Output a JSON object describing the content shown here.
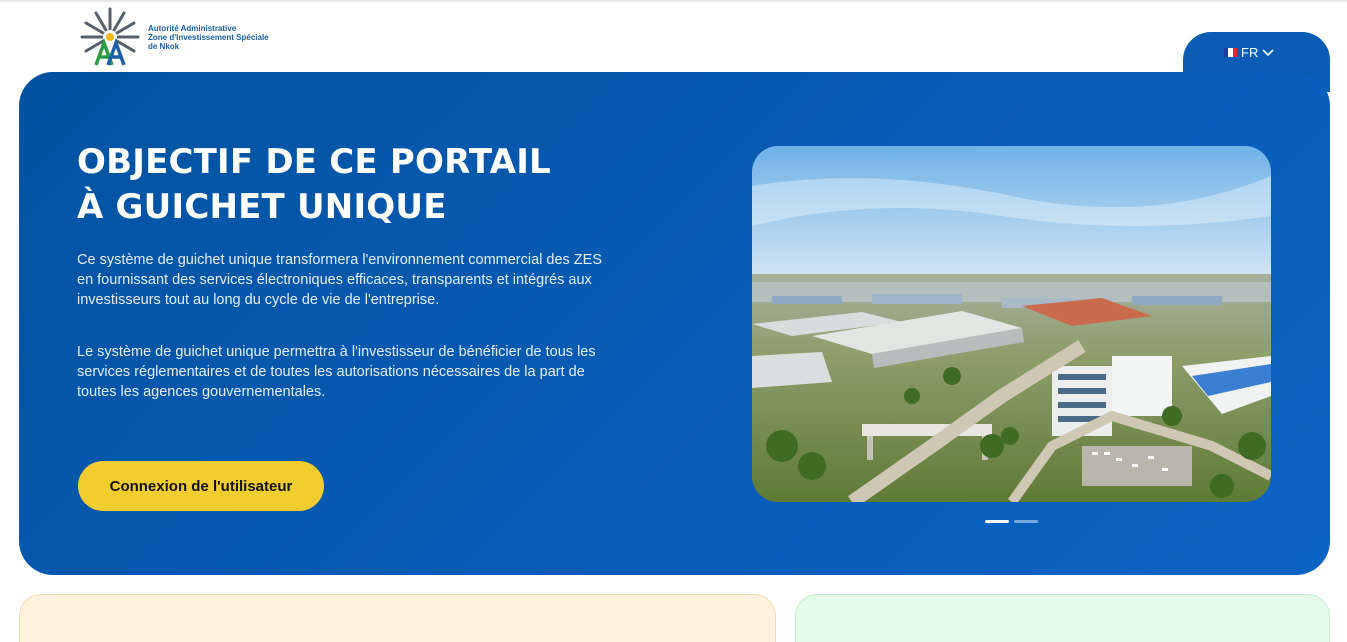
{
  "header": {
    "logo": {
      "icon": "aazes-logo-icon",
      "lines": [
        "Autorité Administrative",
        "Zone d'Investissement Spéciale",
        "de Nkok"
      ]
    },
    "language": {
      "current": "FR",
      "flag_icon": "france-flag-icon",
      "chevron_icon": "chevron-down-icon"
    }
  },
  "hero": {
    "title_lines": [
      "OBJECTIF DE CE PORTAIL",
      "À GUICHET UNIQUE"
    ],
    "paragraph_1": "Ce système de guichet unique transformera l'environnement commercial des ZES en fournissant des services électroniques efficaces, transparents et intégrés aux investisseurs tout au long du cycle de vie de l'entreprise.",
    "paragraph_2": "Le système de guichet unique permettra à l'investisseur de bénéficier de tous les services réglementaires et de toutes les autorisations nécessaires de la part de toutes les agences gouvernementales.",
    "login_button": "Connexion de l'utilisateur",
    "image": "aerial-industrial-zone-photo",
    "carousel": {
      "slides": 2,
      "active": 1
    }
  },
  "colors": {
    "hero_blue": "#0a5cb4",
    "button_yellow": "#f1cd2f",
    "card_left_bg": "#fdf3dd",
    "card_right_bg": "#e3fbe8",
    "logo_text": "#1b5fa8"
  }
}
